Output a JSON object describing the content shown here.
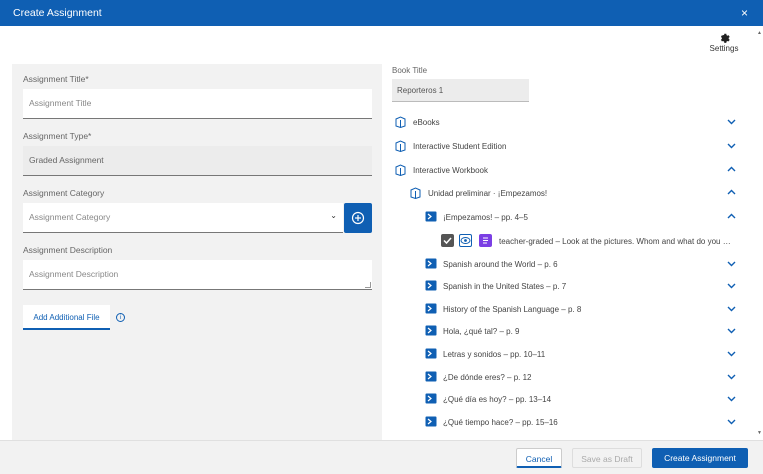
{
  "dialog": {
    "title": "Create Assignment",
    "close_glyph": "×"
  },
  "settings": {
    "label": "Settings",
    "icon": "gear-icon"
  },
  "form": {
    "title_label": "Assignment Title*",
    "title_placeholder": "Assignment Title",
    "type_label": "Assignment Type*",
    "type_value": "Graded Assignment",
    "category_label": "Assignment Category",
    "category_placeholder": "Assignment Category",
    "description_label": "Assignment Description",
    "description_placeholder": "Assignment Description",
    "add_file_label": "Add Additional File",
    "info_glyph": "i"
  },
  "book": {
    "label": "Book Title",
    "value": "Reporteros 1"
  },
  "tree": {
    "items": [
      {
        "label": "eBooks",
        "expanded": false
      },
      {
        "label": "Interactive Student Edition",
        "expanded": false
      },
      {
        "label": "Interactive Workbook",
        "expanded": true
      },
      {
        "label": "Unidad preliminar · ¡Empezamos!",
        "expanded": true
      },
      {
        "label": "¡Empezamos! – pp. 4–5",
        "expanded": true
      },
      {
        "label": "Spanish around the World – p. 6",
        "expanded": false
      },
      {
        "label": "Spanish in the United States – p. 7",
        "expanded": false
      },
      {
        "label": "History of the Spanish Language – p. 8",
        "expanded": false
      },
      {
        "label": "Hola, ¿qué tal? – p. 9",
        "expanded": false
      },
      {
        "label": "Letras y sonidos – pp. 10–11",
        "expanded": false
      },
      {
        "label": "¿De dónde eres? – p. 12",
        "expanded": false
      },
      {
        "label": "¿Qué día es hoy? – pp. 13–14",
        "expanded": false
      },
      {
        "label": "¿Qué tiempo hace? – pp. 15–16",
        "expanded": false
      }
    ],
    "activity": {
      "checked": true,
      "text": "teacher-graded – Look at the pictures. Whom and what do you …"
    }
  },
  "footer": {
    "cancel_label": "Cancel",
    "draft_label": "Save as Draft",
    "create_label": "Create Assignment"
  },
  "colors": {
    "brand": "#0f5fb3",
    "activity_doc": "#7b3fe4"
  }
}
